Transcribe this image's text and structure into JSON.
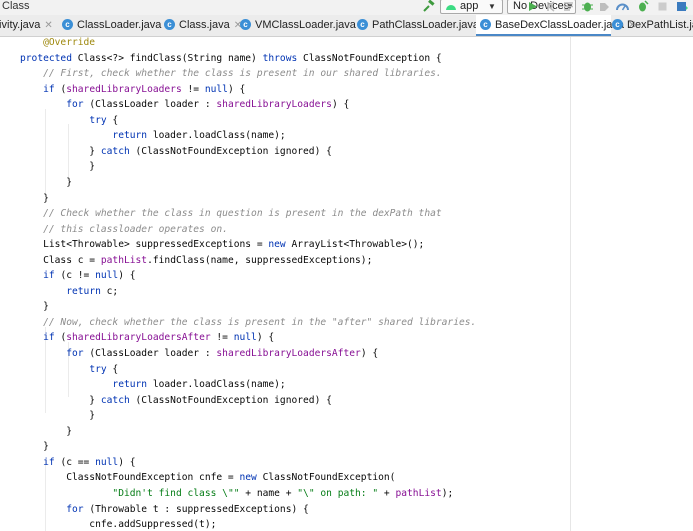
{
  "toolbar": {
    "title": "Class",
    "run_config": "app",
    "device": "No Devices"
  },
  "tabs": [
    {
      "label": "tivity.java",
      "icon": false,
      "active": false
    },
    {
      "label": "ClassLoader.java",
      "icon": true,
      "active": false
    },
    {
      "label": "Class.java",
      "icon": true,
      "active": false
    },
    {
      "label": "VMClassLoader.java",
      "icon": true,
      "active": false
    },
    {
      "label": "PathClassLoader.java",
      "icon": true,
      "active": false
    },
    {
      "label": "BaseDexClassLoader.java",
      "icon": true,
      "active": true
    },
    {
      "label": "DexPathList.ja",
      "icon": true,
      "active": false
    }
  ],
  "code_lines": [
    [
      [
        "ann",
        "    @Override"
      ]
    ],
    [
      [
        "kw",
        "protected "
      ],
      [
        "pl",
        "Class<?> findClass(String name) "
      ],
      [
        "kw",
        "throws "
      ],
      [
        "pl",
        "ClassNotFoundException {"
      ]
    ],
    [
      [
        "cm",
        "    // First, check whether the class is present in our shared libraries."
      ]
    ],
    [
      [
        "pl",
        "    "
      ],
      [
        "kw",
        "if "
      ],
      [
        "pl",
        "("
      ],
      [
        "fd",
        "sharedLibraryLoaders"
      ],
      [
        "pl",
        " != "
      ],
      [
        "kw",
        "null"
      ],
      [
        "pl",
        ") {"
      ]
    ],
    [
      [
        "pl",
        "        "
      ],
      [
        "kw",
        "for "
      ],
      [
        "pl",
        "(ClassLoader loader : "
      ],
      [
        "fd",
        "sharedLibraryLoaders"
      ],
      [
        "pl",
        ") {"
      ]
    ],
    [
      [
        "pl",
        "            "
      ],
      [
        "kw",
        "try "
      ],
      [
        "pl",
        "{"
      ]
    ],
    [
      [
        "pl",
        "                "
      ],
      [
        "kw",
        "return "
      ],
      [
        "pl",
        "loader.loadClass(name);"
      ]
    ],
    [
      [
        "pl",
        "            } "
      ],
      [
        "kw",
        "catch "
      ],
      [
        "pl",
        "(ClassNotFoundException ignored) {"
      ]
    ],
    [
      [
        "pl",
        "            }"
      ]
    ],
    [
      [
        "pl",
        "        }"
      ]
    ],
    [
      [
        "pl",
        "    }"
      ]
    ],
    [
      [
        "cm",
        "    // Check whether the class in question is present in the dexPath that"
      ]
    ],
    [
      [
        "cm",
        "    // this classloader operates on."
      ]
    ],
    [
      [
        "pl",
        "    List<Throwable> suppressedExceptions = "
      ],
      [
        "kw",
        "new "
      ],
      [
        "pl",
        "ArrayList<Throwable>();"
      ]
    ],
    [
      [
        "pl",
        "    Class c = "
      ],
      [
        "fd",
        "pathList"
      ],
      [
        "pl",
        ".findClass(name, suppressedExceptions);"
      ]
    ],
    [
      [
        "pl",
        "    "
      ],
      [
        "kw",
        "if "
      ],
      [
        "pl",
        "(c != "
      ],
      [
        "kw",
        "null"
      ],
      [
        "pl",
        ") {"
      ]
    ],
    [
      [
        "pl",
        "        "
      ],
      [
        "kw",
        "return "
      ],
      [
        "pl",
        "c;"
      ]
    ],
    [
      [
        "pl",
        "    }"
      ]
    ],
    [
      [
        "cm",
        "    // Now, check whether the class is present in the \"after\" shared libraries."
      ]
    ],
    [
      [
        "pl",
        "    "
      ],
      [
        "kw",
        "if "
      ],
      [
        "pl",
        "("
      ],
      [
        "fd",
        "sharedLibraryLoadersAfter"
      ],
      [
        "pl",
        " != "
      ],
      [
        "kw",
        "null"
      ],
      [
        "pl",
        ") {"
      ]
    ],
    [
      [
        "pl",
        "        "
      ],
      [
        "kw",
        "for "
      ],
      [
        "pl",
        "(ClassLoader loader : "
      ],
      [
        "fd",
        "sharedLibraryLoadersAfter"
      ],
      [
        "pl",
        ") {"
      ]
    ],
    [
      [
        "pl",
        "            "
      ],
      [
        "kw",
        "try "
      ],
      [
        "pl",
        "{"
      ]
    ],
    [
      [
        "pl",
        "                "
      ],
      [
        "kw",
        "return "
      ],
      [
        "pl",
        "loader.loadClass(name);"
      ]
    ],
    [
      [
        "pl",
        "            } "
      ],
      [
        "kw",
        "catch "
      ],
      [
        "pl",
        "(ClassNotFoundException ignored) {"
      ]
    ],
    [
      [
        "pl",
        "            }"
      ]
    ],
    [
      [
        "pl",
        "        }"
      ]
    ],
    [
      [
        "pl",
        "    }"
      ]
    ],
    [
      [
        "pl",
        "    "
      ],
      [
        "kw",
        "if "
      ],
      [
        "pl",
        "(c == "
      ],
      [
        "kw",
        "null"
      ],
      [
        "pl",
        ") {"
      ]
    ],
    [
      [
        "pl",
        "        ClassNotFoundException cnfe = "
      ],
      [
        "kw",
        "new "
      ],
      [
        "pl",
        "ClassNotFoundException("
      ]
    ],
    [
      [
        "pl",
        "                "
      ],
      [
        "st",
        "\"Didn't find class \\\"\""
      ],
      [
        "pl",
        " + name + "
      ],
      [
        "st",
        "\"\\\" on path: \""
      ],
      [
        "pl",
        " + "
      ],
      [
        "fd",
        "pathList"
      ],
      [
        "pl",
        ");"
      ]
    ],
    [
      [
        "pl",
        "        "
      ],
      [
        "kw",
        "for "
      ],
      [
        "pl",
        "(Throwable t : suppressedExceptions) {"
      ]
    ],
    [
      [
        "pl",
        "            cnfe.addSuppressed(t);"
      ]
    ],
    [
      [
        "pl",
        "        }"
      ]
    ]
  ],
  "colors": {
    "keyword": "#0033b3",
    "annotation": "#9e880d",
    "comment": "#8c8c8c",
    "string": "#067d17",
    "field": "#871094",
    "active_tab_underline": "#4a88c7",
    "class_icon": "#3b8fd6"
  },
  "icons": [
    "hammer-icon",
    "android-icon",
    "dropdown-arrow-icon",
    "run-icon",
    "debug-icon",
    "coverage-icon",
    "profile-icon",
    "stop-icon",
    "sdk-manager-icon",
    "class-icon",
    "close-icon"
  ]
}
